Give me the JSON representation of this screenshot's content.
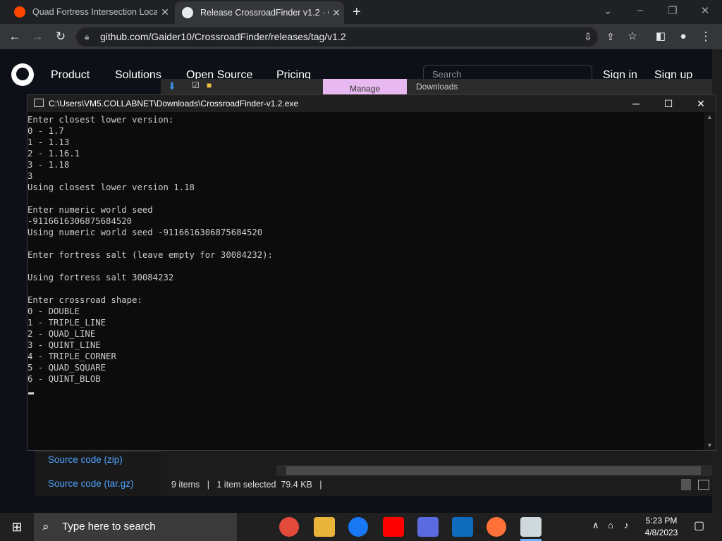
{
  "browser": {
    "tabs": [
      {
        "title": "Quad Fortress Intersection Locat",
        "close": "✕"
      },
      {
        "title": "Release CrossroadFinder v1.2 · G",
        "close": "✕"
      }
    ],
    "new_tab": "+",
    "url": "github.com/Gaider10/CrossroadFinder/releases/tag/v1.2"
  },
  "github": {
    "nav": [
      "Product",
      "Solutions",
      "Open Source",
      "Pricing"
    ],
    "search_placeholder": "Search",
    "sign_in": "Sign in",
    "sign_up": "Sign up"
  },
  "explorer": {
    "manage_label": "Manage",
    "title": "Downloads",
    "links": [
      "Source code (zip)",
      "Source code (tar.gz)"
    ],
    "status": "9 items   |   1 item selected  79.4 KB   |"
  },
  "console": {
    "title": "C:\\Users\\VM5.COLLABNET\\Downloads\\CrossroadFinder-v1.2.exe",
    "lines": [
      "Enter closest lower version:",
      "0 - 1.7",
      "1 - 1.13",
      "2 - 1.16.1",
      "3 - 1.18",
      "3",
      "Using closest lower version 1.18",
      "",
      "Enter numeric world seed",
      "-9116616306875684520",
      "Using numeric world seed -9116616306875684520",
      "",
      "Enter fortress salt (leave empty for 30084232):",
      "",
      "Using fortress salt 30084232",
      "",
      "Enter crossroad shape:",
      "0 - DOUBLE",
      "1 - TRIPLE_LINE",
      "2 - QUAD_LINE",
      "3 - QUINT_LINE",
      "4 - TRIPLE_CORNER",
      "5 - QUAD_SQUARE",
      "6 - QUINT_BLOB"
    ]
  },
  "taskbar": {
    "search_placeholder": "Type here to search",
    "time": "5:23 PM",
    "date": "4/8/2023"
  },
  "colors": {
    "console_bg": "#0c0c0c",
    "console_text": "#cccccc",
    "link": "#4ea3ff",
    "manage_tab": "#e8b8f0"
  }
}
